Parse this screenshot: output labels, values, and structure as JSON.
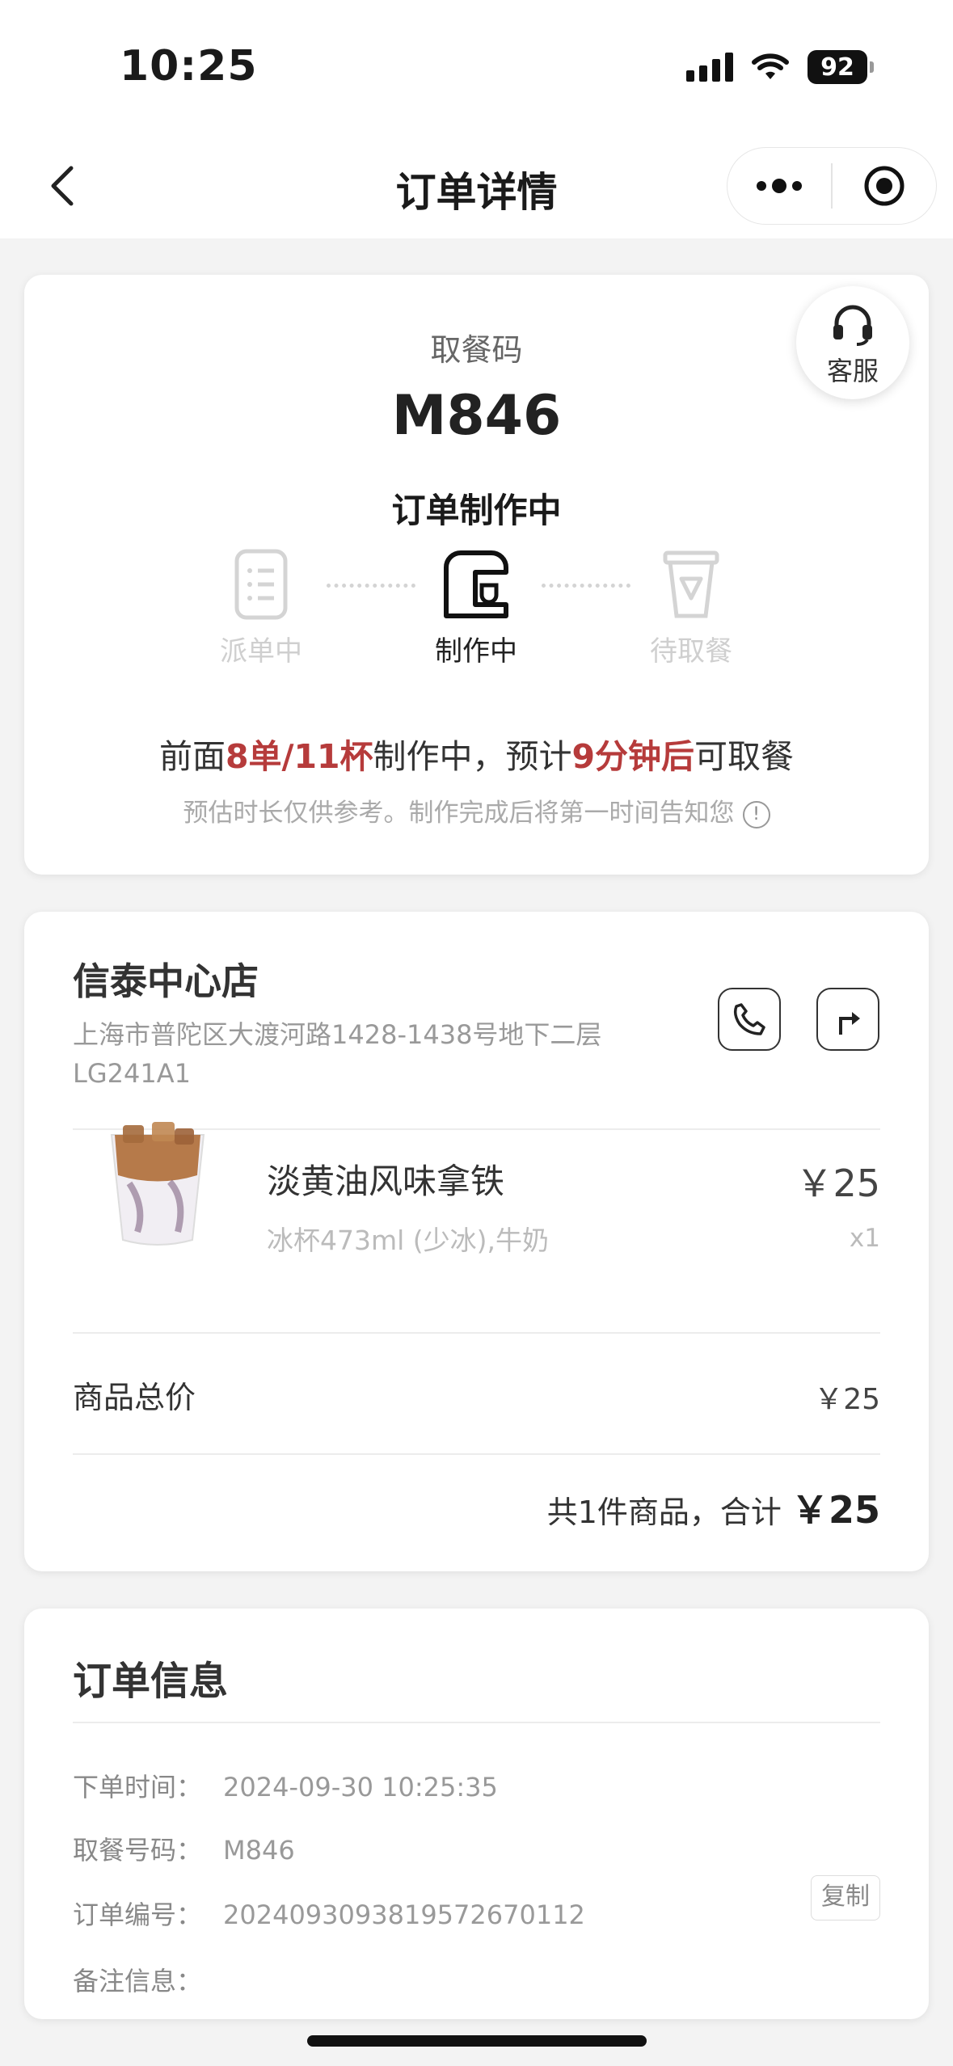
{
  "status_bar": {
    "time": "10:25",
    "battery": "92"
  },
  "nav": {
    "title": "订单详情"
  },
  "pickup": {
    "service_label": "客服",
    "label": "取餐码",
    "code": "M846",
    "status": "订单制作中",
    "steps": [
      "派单中",
      "制作中",
      "待取餐"
    ],
    "active_step": 1,
    "eta": {
      "p1": "前面",
      "p2": "8单/11杯",
      "p3": "制作中，预计",
      "p4": "9分钟后",
      "p5": "可取餐"
    },
    "note": "预估时长仅供参考。制作完成后将第一时间告知您",
    "accent_color": "#b63b3b"
  },
  "store": {
    "name": "信泰中心店",
    "address": "上海市普陀区大渡河路1428-1438号地下二层LG241A1",
    "actions": [
      "phone-icon",
      "navigate-icon"
    ]
  },
  "product": {
    "name": "淡黄油风味拿铁",
    "spec": "冰杯473ml (少冰),牛奶",
    "price": "￥25",
    "qty": "x1"
  },
  "summary": {
    "subtotal_label": "商品总价",
    "subtotal_value": "￥25",
    "total_prefix": "共1件商品，合计",
    "total_value": "￥25"
  },
  "order_info": {
    "title": "订单信息",
    "rows": [
      {
        "label": "下单时间：",
        "value": "2024-09-30 10:25:35"
      },
      {
        "label": "取餐号码：",
        "value": "M846"
      },
      {
        "label": "订单编号：",
        "value": "20240930938195726701​12"
      },
      {
        "label": "备注信息：",
        "value": ""
      }
    ],
    "copy_label": "复制"
  }
}
